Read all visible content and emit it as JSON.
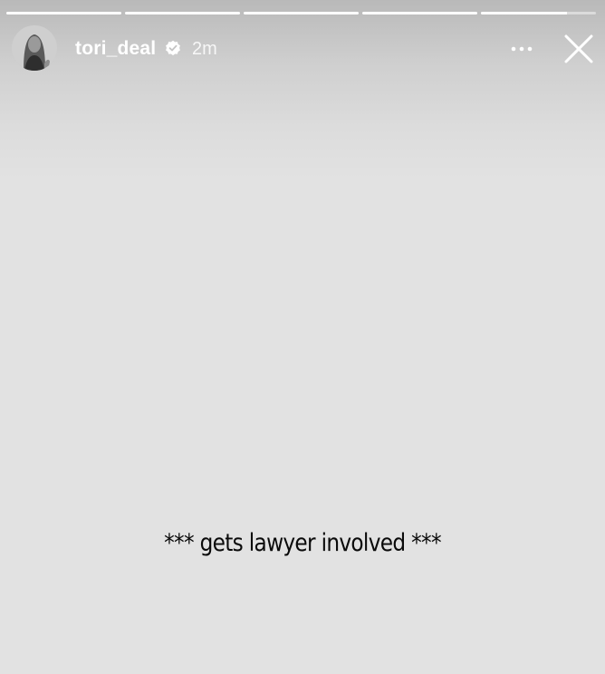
{
  "story": {
    "progress": [
      1,
      1,
      1,
      1,
      0.75
    ],
    "user": {
      "username": "tori_deal",
      "verified": true,
      "posted_ago": "2m",
      "avatar": "profile-photo"
    },
    "controls": {
      "more": "more-options-icon",
      "close": "close-icon"
    },
    "caption": "*** gets lawyer involved ***"
  }
}
